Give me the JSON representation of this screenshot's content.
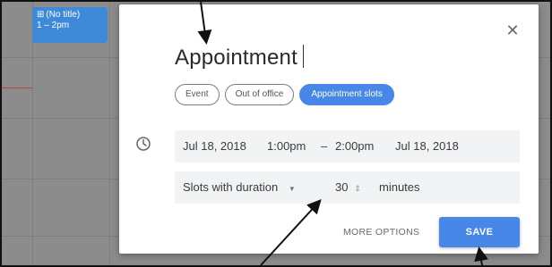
{
  "calendar": {
    "event_chip": {
      "icon": "grid-icon",
      "title": "(No title)",
      "time": "1 – 2pm",
      "color": "#3f8ad8"
    }
  },
  "dialog": {
    "close_icon": "close-icon",
    "title": "Appointment",
    "tabs": [
      {
        "label": "Event",
        "active": false
      },
      {
        "label": "Out of office",
        "active": false
      },
      {
        "label": "Appointment slots",
        "active": true
      }
    ],
    "datetime": {
      "icon": "clock-icon",
      "start_date": "Jul 18, 2018",
      "start_time": "1:00pm",
      "separator": "–",
      "end_time": "2:00pm",
      "end_date": "Jul 18, 2018"
    },
    "slots": {
      "mode_label": "Slots with duration",
      "duration_value": "30",
      "unit": "minutes"
    },
    "actions": {
      "more_options_label": "MORE OPTIONS",
      "save_label": "SAVE"
    },
    "accent_color": "#4787e8"
  }
}
